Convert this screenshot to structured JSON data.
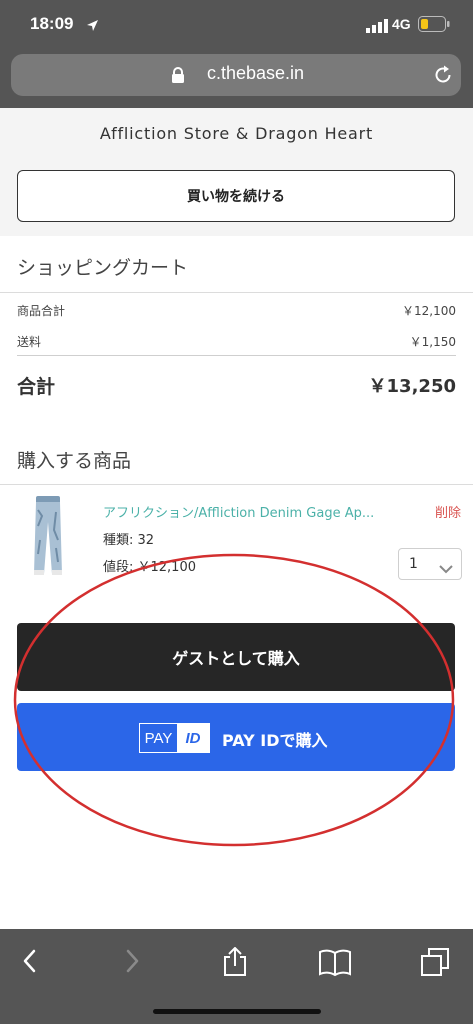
{
  "status_bar": {
    "time": "18:09",
    "network": "4G"
  },
  "browser": {
    "url": "c.thebase.in"
  },
  "store": {
    "name": "Affliction Store & Dragon Heart",
    "continue_button": "買い物を続ける"
  },
  "cart": {
    "title": "ショッピングカート",
    "subtotal_label": "商品合計",
    "subtotal_value": "￥12,100",
    "shipping_label": "送料",
    "shipping_value": "￥1,150",
    "total_label": "合計",
    "total_value": "￥13,250"
  },
  "items_section": {
    "title": "購入する商品",
    "items": [
      {
        "name": "アフリクション/Affliction Denim Gage Ap...",
        "delete_label": "削除",
        "type_label": "種類: 32",
        "price_label": "値段: ￥12,100",
        "quantity": "1"
      }
    ]
  },
  "actions": {
    "guest_purchase": "ゲストとして購入",
    "payid_logo_pay": "PAY",
    "payid_logo_id": "ID",
    "payid_purchase": "PAY IDで購入"
  },
  "colors": {
    "accent_blue": "#2b66e8",
    "dark_button": "#262626",
    "product_link": "#4bb1a8",
    "delete": "#d9534f",
    "annotation": "#d32f2f"
  },
  "icons": [
    "location-arrow-icon",
    "signal-icon",
    "battery-icon",
    "lock-icon",
    "reload-icon",
    "chevron-down-icon",
    "back-icon",
    "forward-icon",
    "share-icon",
    "bookmarks-icon",
    "tabs-icon"
  ]
}
